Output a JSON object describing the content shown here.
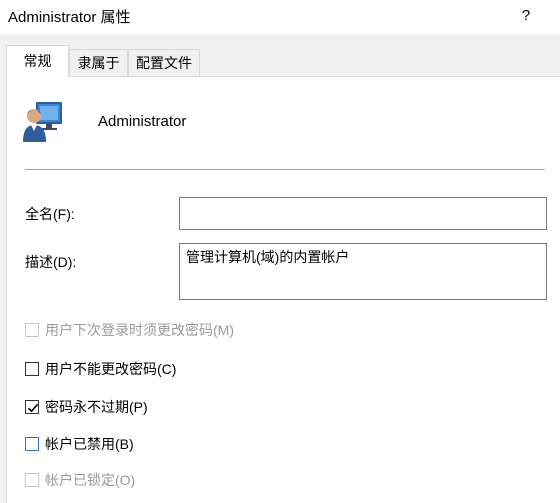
{
  "window": {
    "title": "Administrator 属性",
    "help_label": "?"
  },
  "tabs": [
    {
      "label": "常规",
      "active": true
    },
    {
      "label": "隶属于",
      "active": false
    },
    {
      "label": "配置文件",
      "active": false
    }
  ],
  "user": {
    "name": "Administrator",
    "icon": "user-computer-icon"
  },
  "form": {
    "fullname_label": "全名(F):",
    "fullname_value": "",
    "description_label": "描述(D):",
    "description_value": "管理计算机(域)的内置帐户"
  },
  "checkboxes": [
    {
      "label": "用户下次登录时须更改密码(M)",
      "checked": false,
      "enabled": false
    },
    {
      "label": "用户不能更改密码(C)",
      "checked": false,
      "enabled": true
    },
    {
      "label": "密码永不过期(P)",
      "checked": true,
      "enabled": true
    },
    {
      "label": "帐户已禁用(B)",
      "checked": false,
      "enabled": true
    },
    {
      "label": "帐户已锁定(O)",
      "checked": false,
      "enabled": false
    }
  ],
  "colors": {
    "focus_border": "#2f6fc5",
    "disabled_text": "#9a9a9a",
    "window_bg": "#f0f0f0"
  }
}
